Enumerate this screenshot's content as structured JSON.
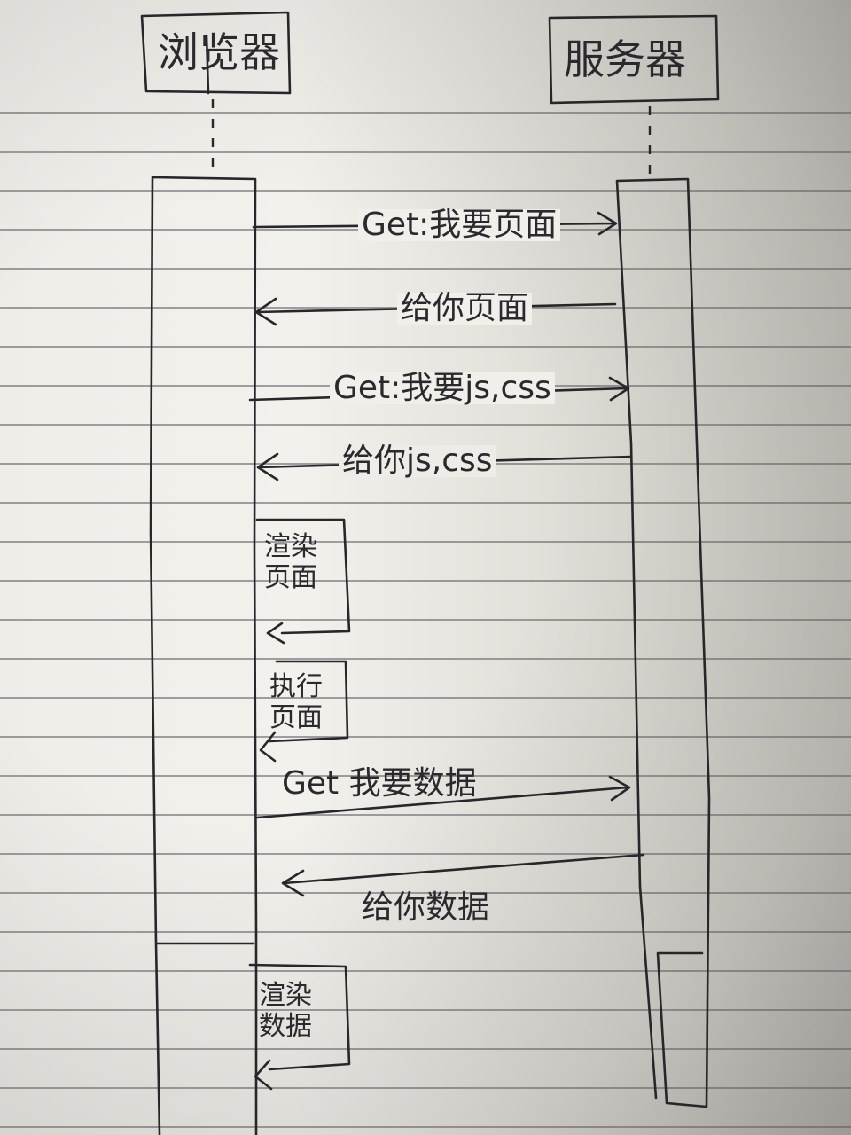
{
  "diagram": {
    "type": "sequence-diagram",
    "actors": {
      "browser": {
        "label": "浏览器"
      },
      "server": {
        "label": "服务器"
      }
    },
    "messages": [
      {
        "id": "m1",
        "label": "Get:我要页面",
        "direction": "browser-to-server"
      },
      {
        "id": "m2",
        "label": "给你页面",
        "direction": "server-to-browser"
      },
      {
        "id": "m3",
        "label": "Get:我要js,css",
        "direction": "browser-to-server"
      },
      {
        "id": "m4",
        "label": "给你js,css",
        "direction": "server-to-browser"
      },
      {
        "id": "m5",
        "label": "Get 我要数据",
        "direction": "browser-to-server"
      },
      {
        "id": "m6",
        "label": "给你数据",
        "direction": "server-to-browser"
      }
    ],
    "self_notes": [
      {
        "id": "n1",
        "label": "渲染页面"
      },
      {
        "id": "n2",
        "label": "执行页面"
      },
      {
        "id": "n3",
        "label": "渲染数据"
      }
    ]
  }
}
